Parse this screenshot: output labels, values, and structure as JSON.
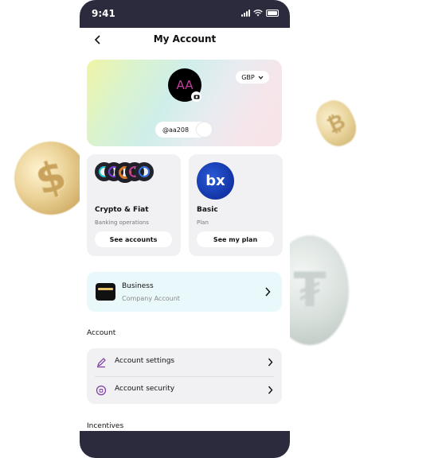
{
  "status": {
    "time": "9:41"
  },
  "header": {
    "title": "My Account",
    "back_icon": "chevron-left-icon"
  },
  "profile": {
    "initials": "AA",
    "currency": "GBP",
    "handle": "@aa208"
  },
  "cards": [
    {
      "title": "Crypto & Fiat",
      "subtitle": "Banking operations",
      "button": "See accounts"
    },
    {
      "title": "Basic",
      "subtitle": "Plan",
      "button": "See my plan",
      "logo_text": "bx"
    }
  ],
  "business": {
    "title": "Business",
    "subtitle": "Company Account"
  },
  "sections": {
    "account": "Account",
    "incentives": "Incentives"
  },
  "account_rows": [
    {
      "label": "Account settings",
      "icon": "edit-icon"
    },
    {
      "label": "Account security",
      "icon": "shield-icon"
    }
  ],
  "colors": {
    "accent": "#2c2b3d",
    "avatar_text": "#c23e9a"
  }
}
